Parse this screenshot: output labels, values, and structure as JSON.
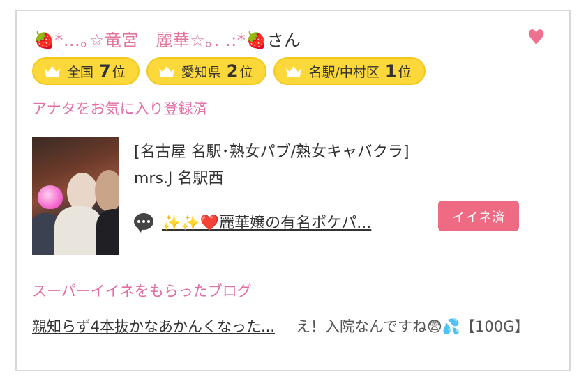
{
  "profile": {
    "name_decorated": "🍓*...｡☆竜宮　麗華☆｡. .:*🍓",
    "honorific": "さん",
    "favorite_icon": "heart-icon",
    "fav_status": "アナタをお気に入り登録済"
  },
  "ranks": [
    {
      "area": "全国",
      "num": "7",
      "suffix": "位"
    },
    {
      "area": "愛知県",
      "num": "2",
      "suffix": "位"
    },
    {
      "area": "名駅/中村区",
      "num": "1",
      "suffix": "位"
    }
  ],
  "shop": {
    "category": "[名古屋 名駅･熟女パブ/熟女キャバクラ]",
    "name": "mrs.J 名駅西"
  },
  "blog": {
    "title": "✨✨❤️麗華嬢の有名ポケパ...",
    "iine_label": "イイネ済"
  },
  "super_iine": {
    "heading": "スーパーイイネをもらったブログ",
    "link_text": "親知らず4本抜かなあかんくなった...",
    "comment": "え！入院なんですね😨💦【100G】"
  },
  "colors": {
    "pink_text": "#e26ea6",
    "badge_yellow": "#fcd83a",
    "button_pink": "#ef6b83",
    "heart": "#f0708f"
  }
}
